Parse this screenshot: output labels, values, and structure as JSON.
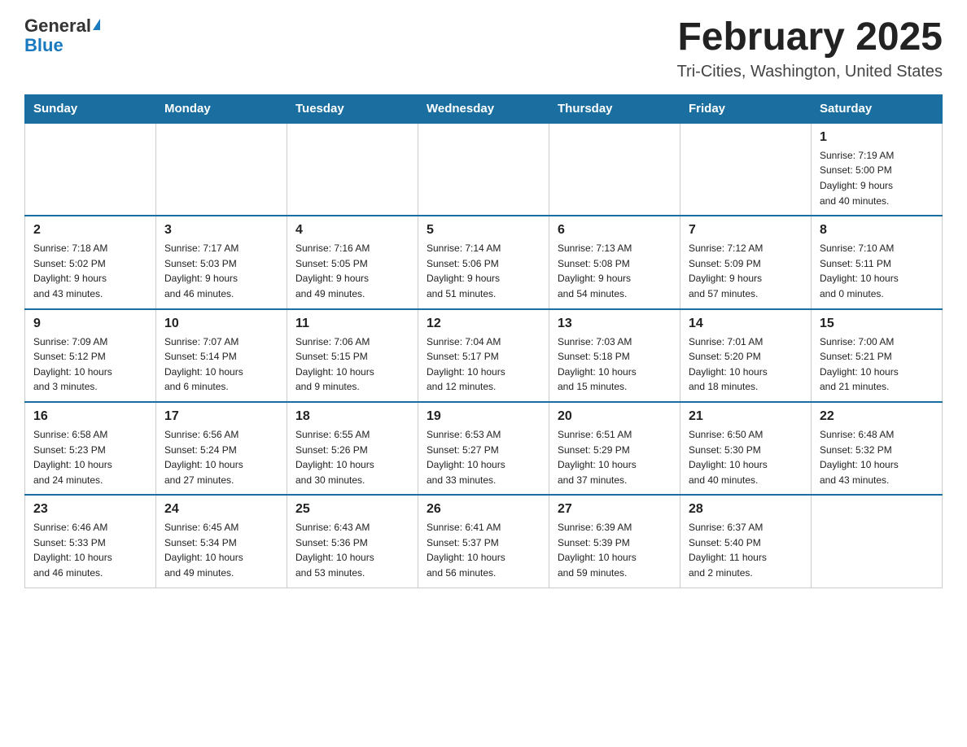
{
  "header": {
    "logo_general": "General",
    "logo_blue": "Blue",
    "title": "February 2025",
    "subtitle": "Tri-Cities, Washington, United States"
  },
  "days_of_week": [
    "Sunday",
    "Monday",
    "Tuesday",
    "Wednesday",
    "Thursday",
    "Friday",
    "Saturday"
  ],
  "weeks": [
    [
      {
        "day": "",
        "info": ""
      },
      {
        "day": "",
        "info": ""
      },
      {
        "day": "",
        "info": ""
      },
      {
        "day": "",
        "info": ""
      },
      {
        "day": "",
        "info": ""
      },
      {
        "day": "",
        "info": ""
      },
      {
        "day": "1",
        "info": "Sunrise: 7:19 AM\nSunset: 5:00 PM\nDaylight: 9 hours\nand 40 minutes."
      }
    ],
    [
      {
        "day": "2",
        "info": "Sunrise: 7:18 AM\nSunset: 5:02 PM\nDaylight: 9 hours\nand 43 minutes."
      },
      {
        "day": "3",
        "info": "Sunrise: 7:17 AM\nSunset: 5:03 PM\nDaylight: 9 hours\nand 46 minutes."
      },
      {
        "day": "4",
        "info": "Sunrise: 7:16 AM\nSunset: 5:05 PM\nDaylight: 9 hours\nand 49 minutes."
      },
      {
        "day": "5",
        "info": "Sunrise: 7:14 AM\nSunset: 5:06 PM\nDaylight: 9 hours\nand 51 minutes."
      },
      {
        "day": "6",
        "info": "Sunrise: 7:13 AM\nSunset: 5:08 PM\nDaylight: 9 hours\nand 54 minutes."
      },
      {
        "day": "7",
        "info": "Sunrise: 7:12 AM\nSunset: 5:09 PM\nDaylight: 9 hours\nand 57 minutes."
      },
      {
        "day": "8",
        "info": "Sunrise: 7:10 AM\nSunset: 5:11 PM\nDaylight: 10 hours\nand 0 minutes."
      }
    ],
    [
      {
        "day": "9",
        "info": "Sunrise: 7:09 AM\nSunset: 5:12 PM\nDaylight: 10 hours\nand 3 minutes."
      },
      {
        "day": "10",
        "info": "Sunrise: 7:07 AM\nSunset: 5:14 PM\nDaylight: 10 hours\nand 6 minutes."
      },
      {
        "day": "11",
        "info": "Sunrise: 7:06 AM\nSunset: 5:15 PM\nDaylight: 10 hours\nand 9 minutes."
      },
      {
        "day": "12",
        "info": "Sunrise: 7:04 AM\nSunset: 5:17 PM\nDaylight: 10 hours\nand 12 minutes."
      },
      {
        "day": "13",
        "info": "Sunrise: 7:03 AM\nSunset: 5:18 PM\nDaylight: 10 hours\nand 15 minutes."
      },
      {
        "day": "14",
        "info": "Sunrise: 7:01 AM\nSunset: 5:20 PM\nDaylight: 10 hours\nand 18 minutes."
      },
      {
        "day": "15",
        "info": "Sunrise: 7:00 AM\nSunset: 5:21 PM\nDaylight: 10 hours\nand 21 minutes."
      }
    ],
    [
      {
        "day": "16",
        "info": "Sunrise: 6:58 AM\nSunset: 5:23 PM\nDaylight: 10 hours\nand 24 minutes."
      },
      {
        "day": "17",
        "info": "Sunrise: 6:56 AM\nSunset: 5:24 PM\nDaylight: 10 hours\nand 27 minutes."
      },
      {
        "day": "18",
        "info": "Sunrise: 6:55 AM\nSunset: 5:26 PM\nDaylight: 10 hours\nand 30 minutes."
      },
      {
        "day": "19",
        "info": "Sunrise: 6:53 AM\nSunset: 5:27 PM\nDaylight: 10 hours\nand 33 minutes."
      },
      {
        "day": "20",
        "info": "Sunrise: 6:51 AM\nSunset: 5:29 PM\nDaylight: 10 hours\nand 37 minutes."
      },
      {
        "day": "21",
        "info": "Sunrise: 6:50 AM\nSunset: 5:30 PM\nDaylight: 10 hours\nand 40 minutes."
      },
      {
        "day": "22",
        "info": "Sunrise: 6:48 AM\nSunset: 5:32 PM\nDaylight: 10 hours\nand 43 minutes."
      }
    ],
    [
      {
        "day": "23",
        "info": "Sunrise: 6:46 AM\nSunset: 5:33 PM\nDaylight: 10 hours\nand 46 minutes."
      },
      {
        "day": "24",
        "info": "Sunrise: 6:45 AM\nSunset: 5:34 PM\nDaylight: 10 hours\nand 49 minutes."
      },
      {
        "day": "25",
        "info": "Sunrise: 6:43 AM\nSunset: 5:36 PM\nDaylight: 10 hours\nand 53 minutes."
      },
      {
        "day": "26",
        "info": "Sunrise: 6:41 AM\nSunset: 5:37 PM\nDaylight: 10 hours\nand 56 minutes."
      },
      {
        "day": "27",
        "info": "Sunrise: 6:39 AM\nSunset: 5:39 PM\nDaylight: 10 hours\nand 59 minutes."
      },
      {
        "day": "28",
        "info": "Sunrise: 6:37 AM\nSunset: 5:40 PM\nDaylight: 11 hours\nand 2 minutes."
      },
      {
        "day": "",
        "info": ""
      }
    ]
  ]
}
